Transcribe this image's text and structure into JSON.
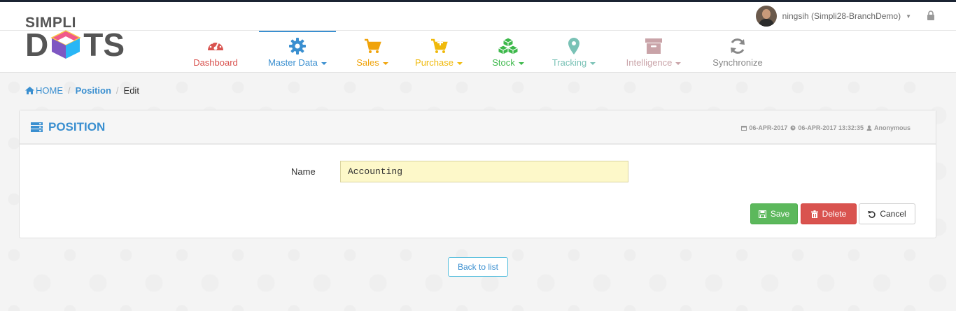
{
  "header": {
    "user_label": "ningsih (Simpli28-BranchDemo)",
    "logo_top": "SIMPLI",
    "logo_letters_left": "D",
    "logo_letters_right": "TS"
  },
  "nav": {
    "items": [
      {
        "label": "Dashboard",
        "color": "#d9534f",
        "icon": "gauge-icon",
        "dropdown": false
      },
      {
        "label": "Master Data",
        "color": "#3a8fd0",
        "icon": "gear-icon",
        "dropdown": true,
        "active": true
      },
      {
        "label": "Sales",
        "color": "#f0a30a",
        "icon": "cart-icon",
        "dropdown": true
      },
      {
        "label": "Purchase",
        "color": "#f0b90a",
        "icon": "cart-plus-icon",
        "dropdown": true
      },
      {
        "label": "Stock",
        "color": "#3cb84a",
        "icon": "cubes-icon",
        "dropdown": true
      },
      {
        "label": "Tracking",
        "color": "#7ac2b6",
        "icon": "map-marker-icon",
        "dropdown": true
      },
      {
        "label": "Intelligence",
        "color": "#c9a3a8",
        "icon": "archive-icon",
        "dropdown": true
      },
      {
        "label": "Synchronize",
        "color": "#888888",
        "icon": "refresh-icon",
        "dropdown": false
      }
    ]
  },
  "breadcrumb": {
    "home": "HOME",
    "parent": "Position",
    "current": "Edit",
    "separator": "/"
  },
  "panel": {
    "title": "POSITION",
    "created": "06-APR-2017",
    "modified": "06-APR-2017 13:32:35",
    "author": "Anonymous"
  },
  "form": {
    "name_label": "Name",
    "name_value": "Accounting"
  },
  "actions": {
    "save": "Save",
    "delete": "Delete",
    "cancel": "Cancel",
    "back": "Back to list"
  },
  "colors": {
    "accent": "#3a8fd0",
    "save": "#5cb85c",
    "delete": "#d9534f",
    "input_bg": "#fdf8c9"
  }
}
